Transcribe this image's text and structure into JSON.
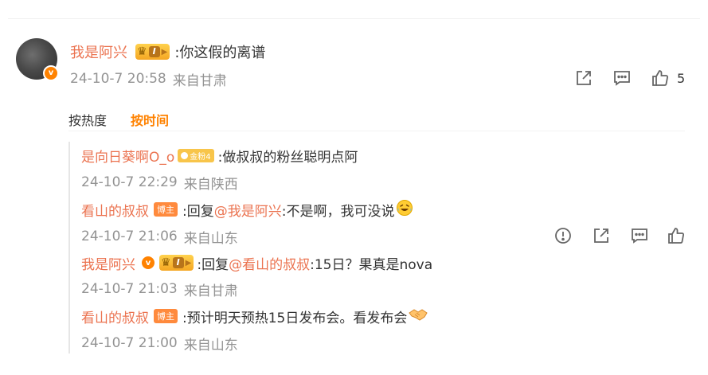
{
  "main_comment": {
    "username": "我是阿兴",
    "level": "I",
    "text": ":你这假的离谱",
    "time": "24-10-7 20:58",
    "source": "来自甘肃",
    "like_count": "5",
    "icons": [
      "share-icon",
      "comment-icon",
      "like-icon"
    ]
  },
  "sort_tabs": [
    {
      "label": "按热度",
      "active": false
    },
    {
      "label": "按时间",
      "active": true
    }
  ],
  "replies": [
    {
      "username": "是向日葵啊O_o",
      "badge": "金粉4",
      "text": ":做叔叔的粉丝聪明点阿",
      "time": "24-10-7 22:29",
      "source": "来自陕西"
    },
    {
      "username": "看山的叔叔",
      "badge": "博主",
      "reply_prefix": ":回复",
      "mention": "@我是阿兴",
      "text": ":不是啊，我可没说",
      "time": "24-10-7 21:06",
      "source": "来自山东",
      "icons": [
        "report-icon",
        "share-icon",
        "comment-icon",
        "like-icon"
      ]
    },
    {
      "username": "我是阿兴",
      "level": "I",
      "reply_prefix": ":回复",
      "mention": "@看山的叔叔",
      "text": ":15日？果真是nova",
      "time": "24-10-7 21:03",
      "source": "来自甘肃"
    },
    {
      "username": "看山的叔叔",
      "badge": "博主",
      "text": ":预计明天预热15日发布会。看发布会",
      "time": "24-10-7 21:00",
      "source": "来自山东"
    }
  ],
  "colors": {
    "accent": "#ff8200",
    "username": "#eb7350",
    "meta": "#939393"
  }
}
